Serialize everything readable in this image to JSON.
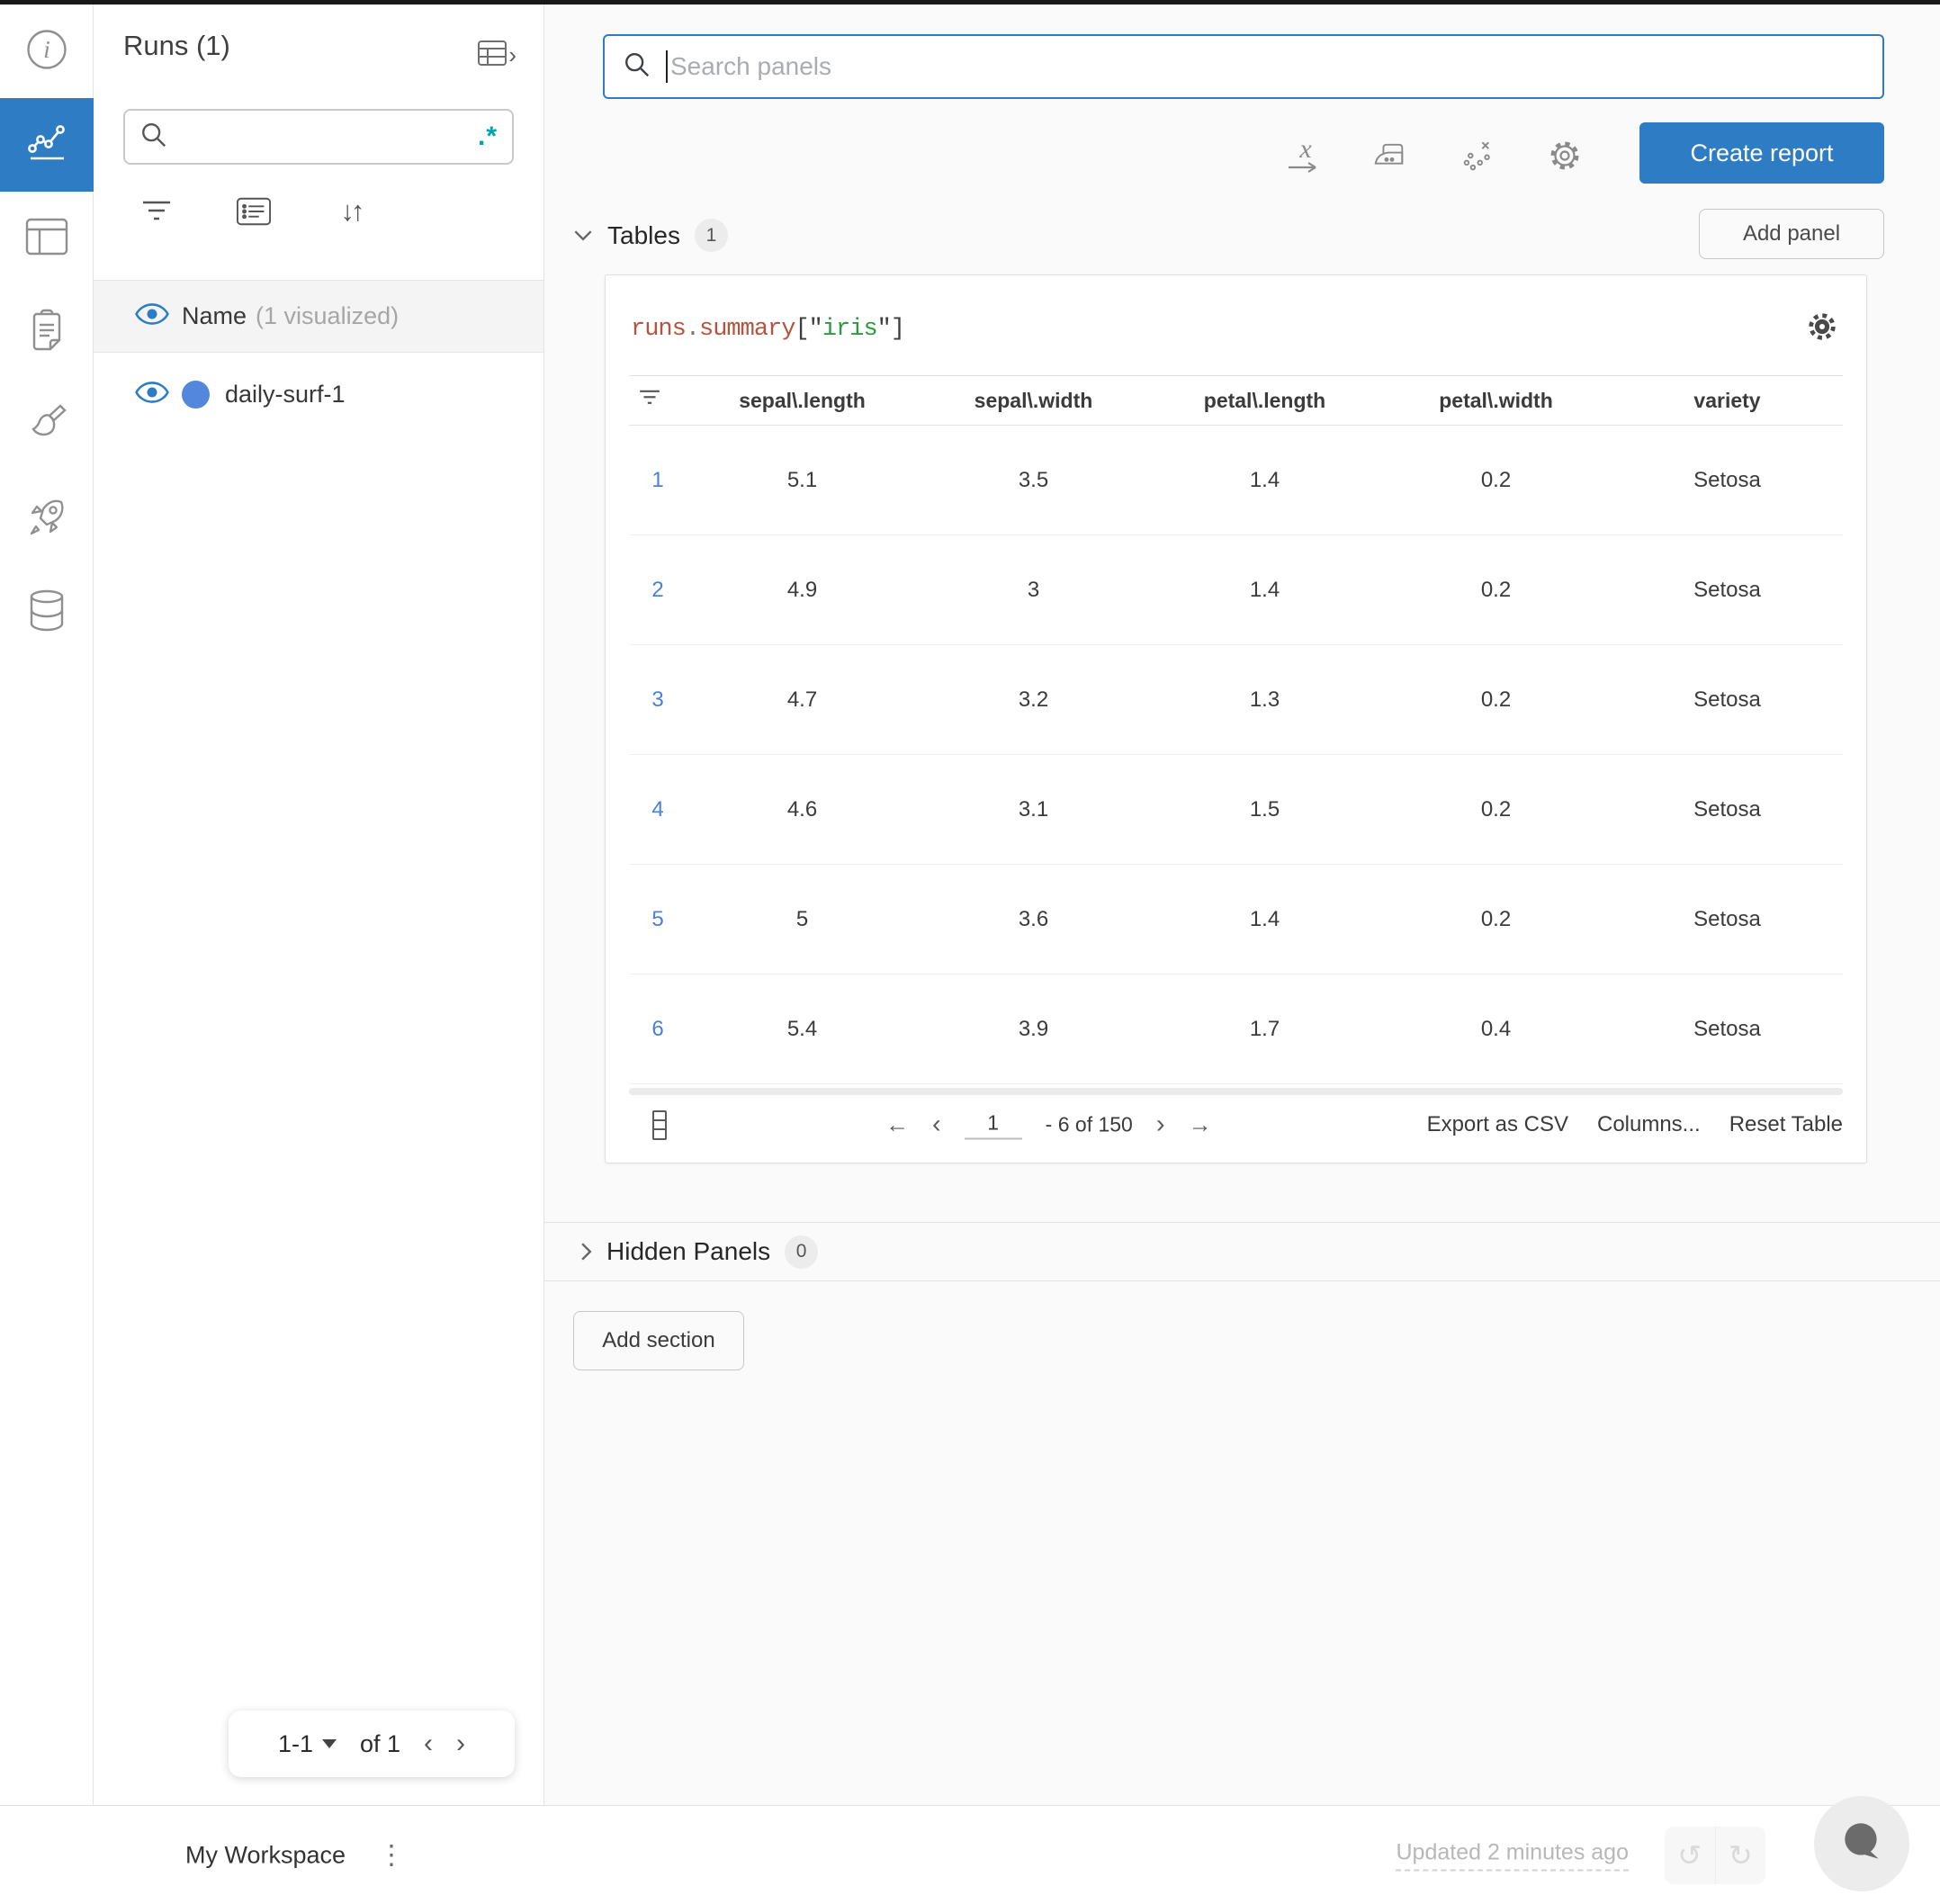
{
  "colors": {
    "accent": "#2e7dc4",
    "run_dot": "#5387dd",
    "regex_teal": "#00a1b3",
    "code_orange": "#b5543f",
    "code_green": "#2b9a3e",
    "link_blue": "#4b7fd9"
  },
  "icon_rail": {
    "icons": [
      "info-icon",
      "line-chart-icon",
      "panel-grid-icon",
      "clipboard-icon",
      "broom-icon",
      "rocket-icon",
      "database-icon"
    ],
    "active_icon": "line-chart-icon"
  },
  "sidebar": {
    "title": "Runs (1)",
    "search_value": "",
    "regex_toggle": ".*",
    "name_header_label": "Name",
    "name_header_suffix": "(1 visualized)",
    "runs": [
      {
        "name": "daily-surf-1"
      }
    ],
    "pagination": {
      "range": "1-1",
      "of_label": "of 1",
      "prev": "‹",
      "next": "›"
    }
  },
  "main": {
    "panel_search_placeholder": "Search panels",
    "create_report_label": "Create report",
    "tables_section": {
      "label": "Tables",
      "count": "1"
    },
    "add_panel_label": "Add panel",
    "hidden_section": {
      "label": "Hidden Panels",
      "count": "0"
    },
    "add_section_label": "Add section"
  },
  "table_panel": {
    "title": {
      "obj": "runs",
      "dot": ".",
      "attr": "summary",
      "open": "[\"",
      "key": "iris",
      "close": "\"]"
    },
    "columns": [
      "sepal\\.length",
      "sepal\\.width",
      "petal\\.length",
      "petal\\.width",
      "variety"
    ],
    "rows": [
      {
        "n": "1",
        "c1": "5.1",
        "c2": "3.5",
        "c3": "1.4",
        "c4": "0.2",
        "c5": "Setosa"
      },
      {
        "n": "2",
        "c1": "4.9",
        "c2": "3",
        "c3": "1.4",
        "c4": "0.2",
        "c5": "Setosa"
      },
      {
        "n": "3",
        "c1": "4.7",
        "c2": "3.2",
        "c3": "1.3",
        "c4": "0.2",
        "c5": "Setosa"
      },
      {
        "n": "4",
        "c1": "4.6",
        "c2": "3.1",
        "c3": "1.5",
        "c4": "0.2",
        "c5": "Setosa"
      },
      {
        "n": "5",
        "c1": "5",
        "c2": "3.6",
        "c3": "1.4",
        "c4": "0.2",
        "c5": "Setosa"
      },
      {
        "n": "6",
        "c1": "5.4",
        "c2": "3.9",
        "c3": "1.7",
        "c4": "0.4",
        "c5": "Setosa"
      }
    ],
    "footer": {
      "page": "1",
      "range": "- 6 of 150",
      "prev_page": "←",
      "prev": "‹",
      "next": "›",
      "next_page": "→",
      "export_label": "Export as CSV",
      "columns_label": "Columns...",
      "reset_label": "Reset Table"
    }
  },
  "statusbar": {
    "workspace": "My Workspace",
    "updated": "Updated 2 minutes ago",
    "undo": "↺",
    "redo": "↻",
    "kebab": "⋮"
  }
}
